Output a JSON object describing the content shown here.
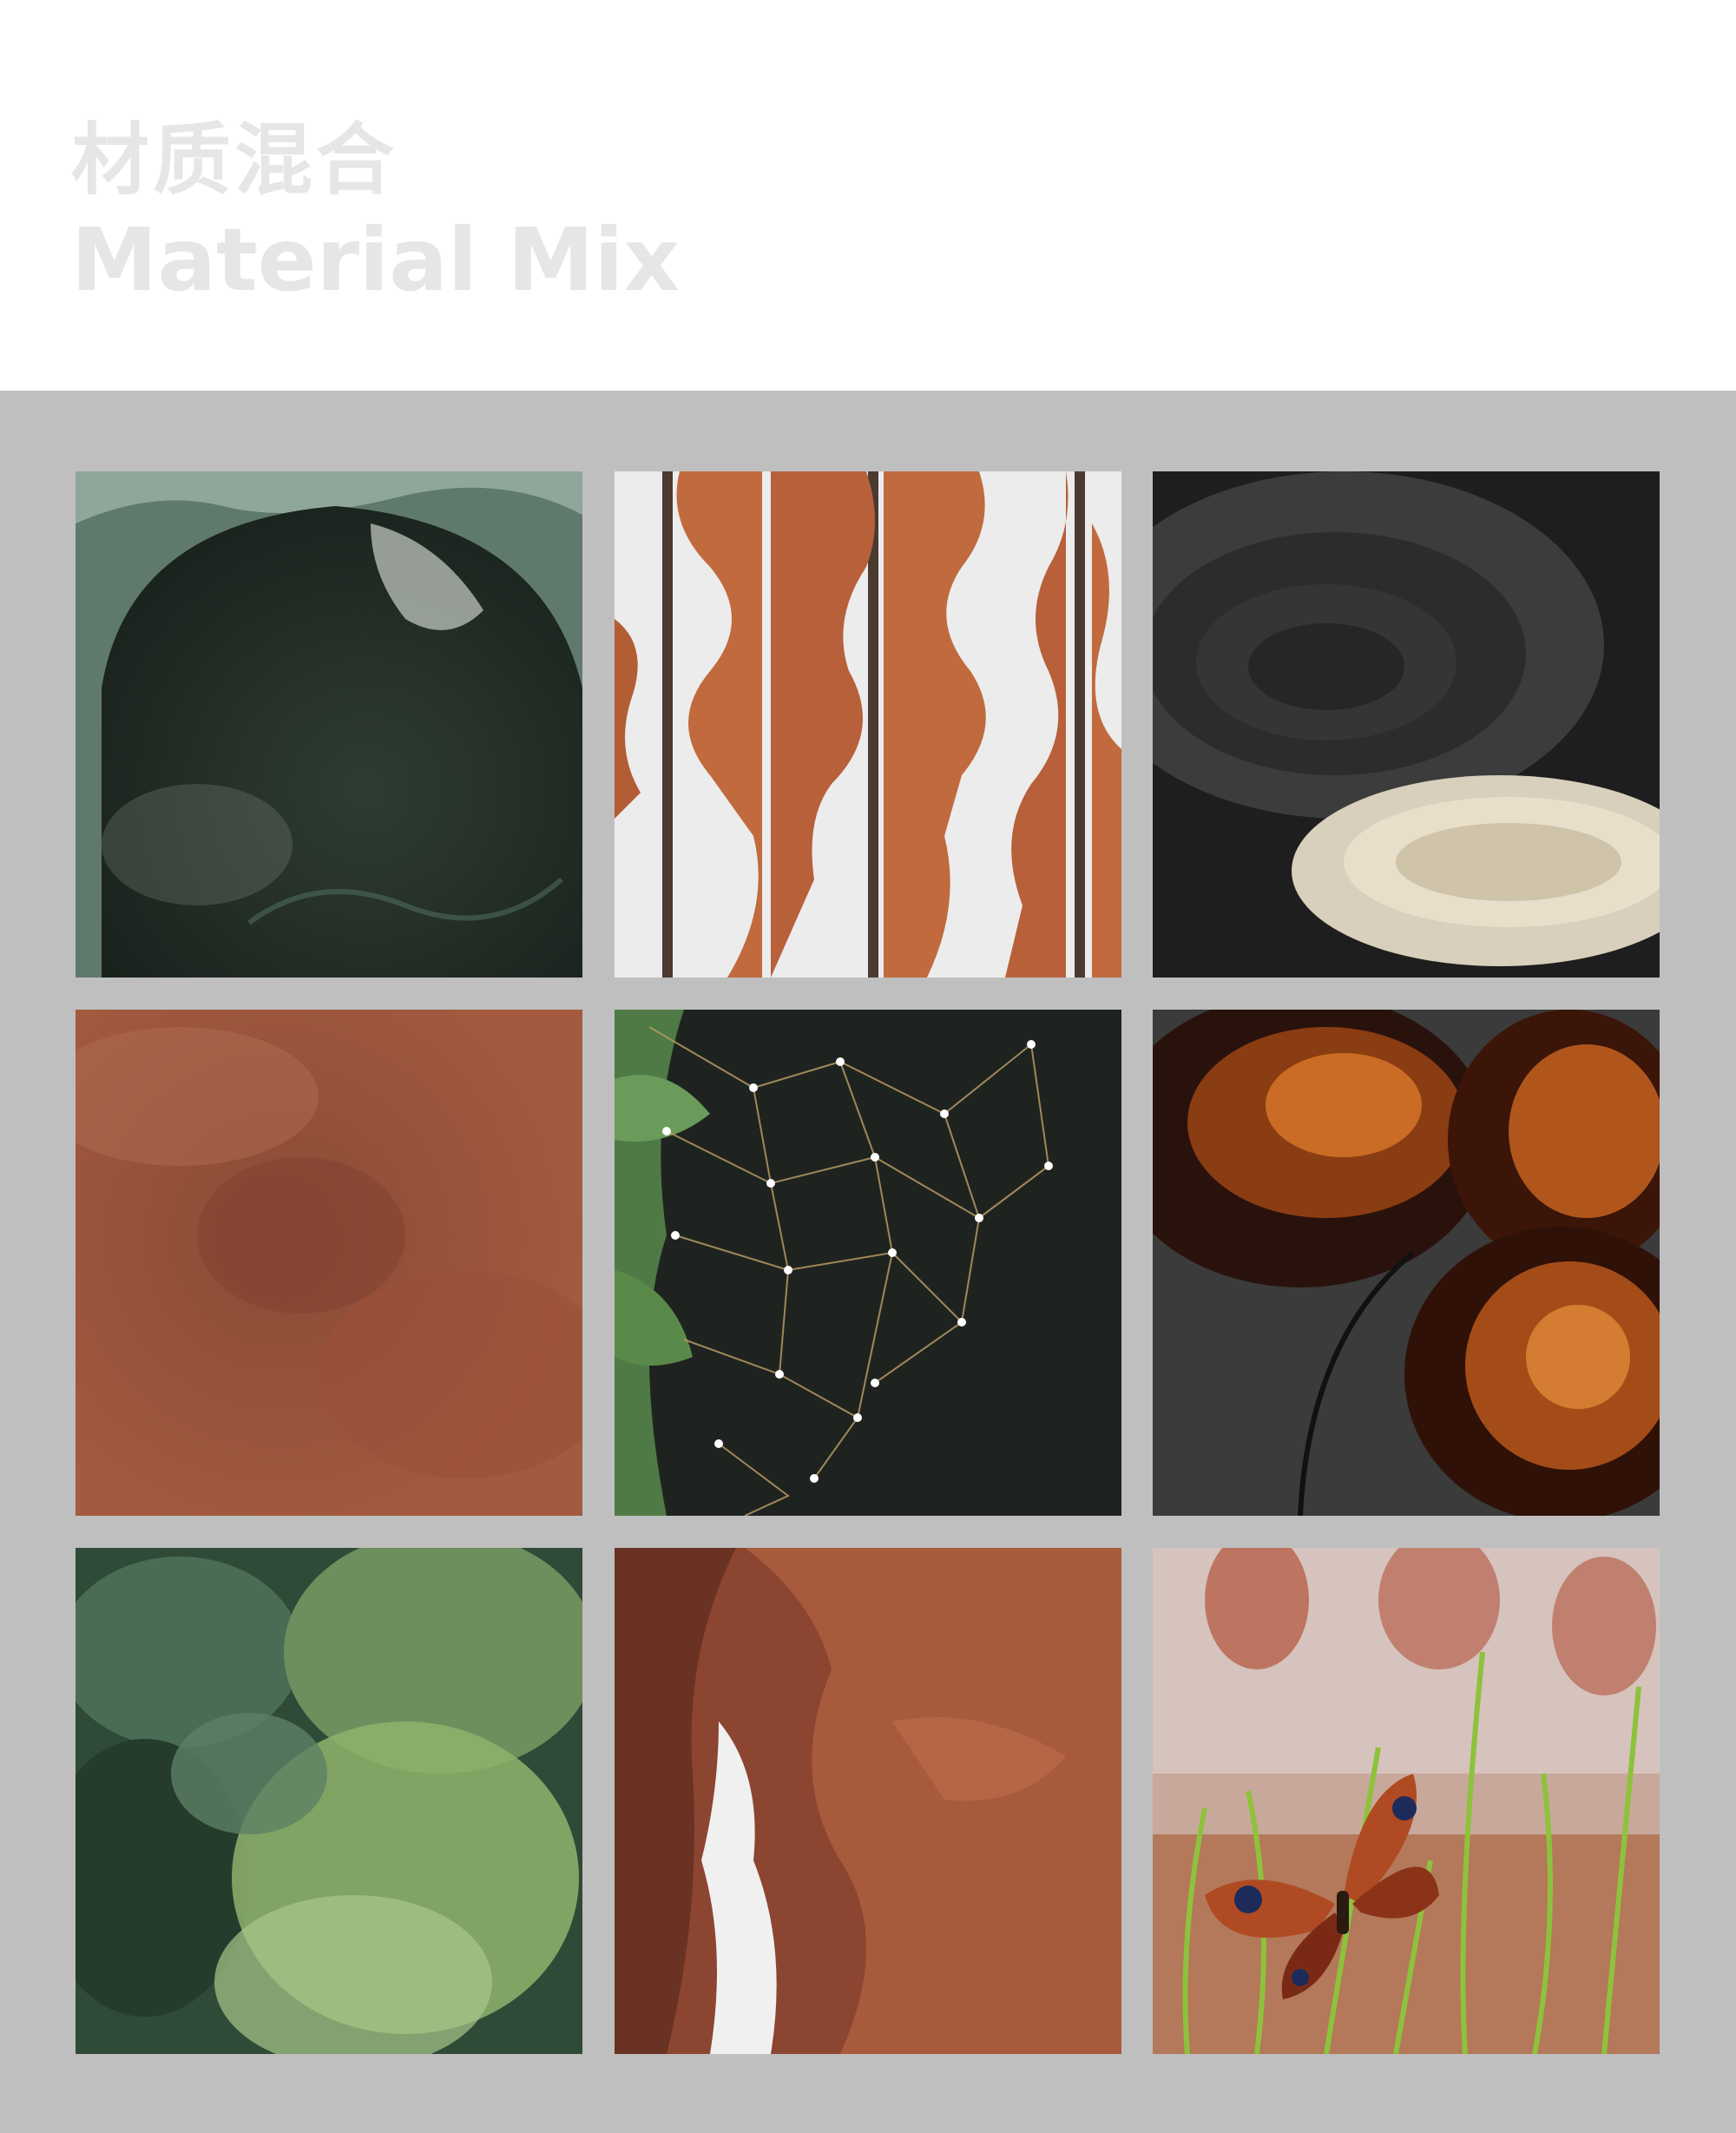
{
  "title": {
    "cn": "材质混合",
    "en": "Material Mix",
    "color": "#e6e6e6"
  },
  "panel_background": "#bfbfbf",
  "tiles": [
    {
      "subject": "green marble arch"
    },
    {
      "subject": "orange leather screen panels"
    },
    {
      "subject": "porous stone trays"
    },
    {
      "subject": "rust suede texture"
    },
    {
      "subject": "wire light net with ferns"
    },
    {
      "subject": "amber glass lamp on slate"
    },
    {
      "subject": "green foliage wall"
    },
    {
      "subject": "red sandstone canyon"
    },
    {
      "subject": "butterfly on green sprouts"
    }
  ]
}
